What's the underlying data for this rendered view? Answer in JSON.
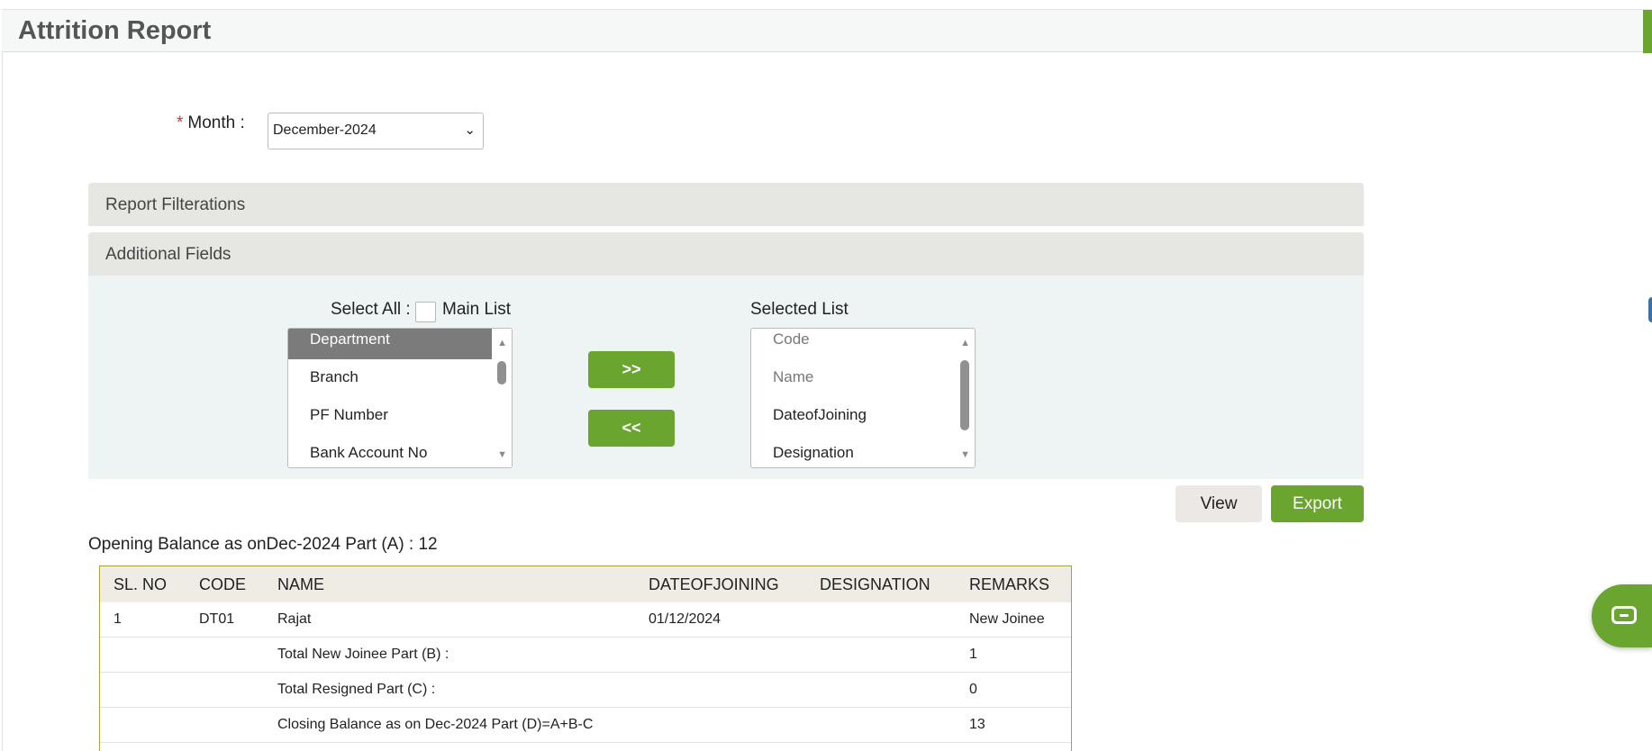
{
  "header": {
    "title": "Attrition Report"
  },
  "filters": {
    "month_label": "Month :",
    "required_mark": "*",
    "month_value": "December-2024"
  },
  "sections": {
    "report_filterations": "Report Filterations",
    "additional_fields": "Additional Fields"
  },
  "fields": {
    "select_all_label": "Select All :",
    "main_list_label": "Main List",
    "selected_list_label": "Selected List",
    "main_list_items": [
      "Department",
      "Branch",
      "PF Number",
      "Bank Account No"
    ],
    "selected_list_items": [
      "Code",
      "Name",
      "DateofJoining",
      "Designation"
    ],
    "move_right_label": ">>",
    "move_left_label": "<<"
  },
  "actions": {
    "view_label": "View",
    "export_label": "Export"
  },
  "report": {
    "opening_balance": "Opening Balance as onDec-2024 Part (A) : 12",
    "columns": [
      "SL. NO",
      "CODE",
      "NAME",
      "DATEOFJOINING",
      "DESIGNATION",
      "REMARKS"
    ],
    "rows": [
      {
        "sl": "1",
        "code": "DT01",
        "name": "Rajat",
        "doj": "01/12/2024",
        "designation": "",
        "remarks": "New Joinee"
      }
    ],
    "summary": [
      {
        "label": "Total New Joinee Part (B) :",
        "value": "1"
      },
      {
        "label": "Total Resigned Part (C) :",
        "value": "0"
      },
      {
        "label": "Closing Balance as on Dec-2024 Part (D)=A+B-C",
        "value": "13"
      }
    ]
  },
  "colors": {
    "accent": "#6aa52f",
    "section_bar": "#e6e6e3",
    "fields_bg": "#eef3f4"
  },
  "icons": {
    "chat": "chat-icon",
    "dropdown": "chevron-down-icon"
  }
}
